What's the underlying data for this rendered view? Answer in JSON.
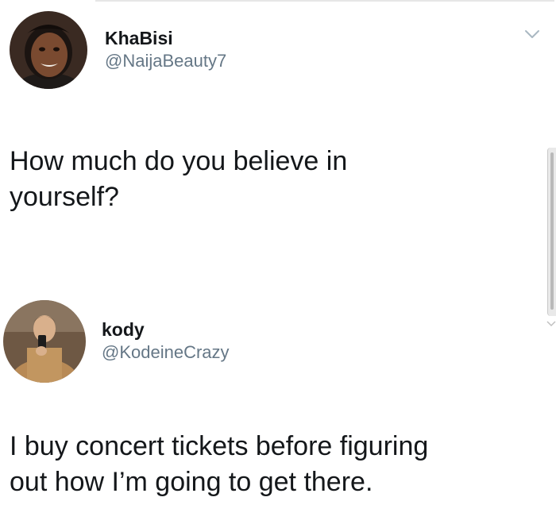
{
  "tweet1": {
    "display_name": "KhaBisi",
    "handle": "@NaijaBeauty7",
    "text": "How much do you believe in\nyourself?"
  },
  "tweet2": {
    "display_name": "kody",
    "handle": "@KodeineCrazy",
    "text": "I buy concert tickets before figuring\nout how I’m going to get there."
  },
  "icons": {
    "menu": "chevron-down-icon",
    "avatar1": "avatar-photo",
    "avatar2": "avatar-photo"
  },
  "colors": {
    "text": "#14171a",
    "handle": "#657786",
    "background": "#ffffff"
  }
}
